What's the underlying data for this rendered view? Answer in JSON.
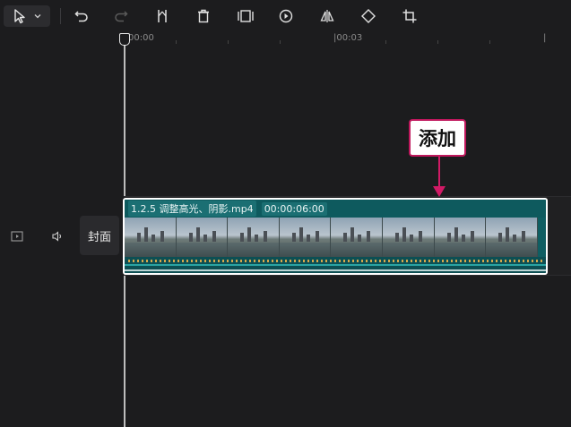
{
  "toolbar": {
    "tools": [
      {
        "name": "select-tool",
        "icon": "cursor-arrow-icon"
      },
      {
        "name": "undo",
        "icon": "undo-icon"
      },
      {
        "name": "redo",
        "icon": "redo-icon"
      },
      {
        "name": "split",
        "icon": "split-icon"
      },
      {
        "name": "delete",
        "icon": "trash-icon"
      },
      {
        "name": "freeze-frame",
        "icon": "freeze-frame-icon"
      },
      {
        "name": "reverse",
        "icon": "reverse-icon"
      },
      {
        "name": "mirror",
        "icon": "mirror-icon"
      },
      {
        "name": "rotate",
        "icon": "rotate-icon"
      },
      {
        "name": "crop",
        "icon": "crop-icon"
      }
    ]
  },
  "ruler": {
    "labels": [
      "00:00",
      "|00:03",
      "|"
    ]
  },
  "track": {
    "cover_label": "封面"
  },
  "clip": {
    "title": "1.2.5 调整高光、阴影.mp4",
    "duration": "00:00:06:00"
  },
  "annotation": {
    "label": "添加",
    "color": "#c0185d"
  }
}
